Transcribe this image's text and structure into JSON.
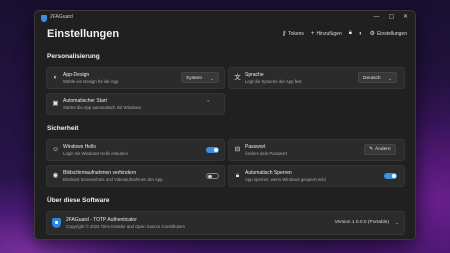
{
  "window": {
    "app_name": "2FAGuard",
    "controls": {
      "minimize": "—",
      "maximize": "▢",
      "close": "✕"
    }
  },
  "page": {
    "heading": "Einstellungen"
  },
  "toolbar": {
    "tokens": "Tokens",
    "add": "Hinzufügen",
    "settings": "Einstellungen"
  },
  "sections": {
    "personalization": "Personalisierung",
    "security": "Sicherheit",
    "about": "Über diese Software"
  },
  "personalization": {
    "design": {
      "title": "App-Design",
      "desc": "Wähle ein Design für die App",
      "value": "System"
    },
    "language": {
      "title": "Sprache",
      "desc": "Legt die Sprache der App fest",
      "value": "Deutsch"
    },
    "autostart": {
      "title": "Automatischer Start",
      "desc": "Startet die App automatisch mit Windows",
      "enabled": false
    }
  },
  "security": {
    "hello": {
      "title": "Windows Hello",
      "desc": "Login mit Windows Hello erlauben",
      "enabled": true
    },
    "password": {
      "title": "Passwort",
      "desc": "Ändere dein Passwort",
      "button": "Ändern"
    },
    "screenshots": {
      "title": "Bildschirmaufnahmen verhindern",
      "desc": "Blockiert Screenshots und Videoaufnahmen der App",
      "enabled": false
    },
    "autolock": {
      "title": "Automatisch Sperren",
      "desc": "App sperren, wenn Windows gesperrt wird",
      "enabled": true
    }
  },
  "about": {
    "title": "2FAGuard - TOTP Authenticator",
    "copyright": "Copyright © 2024 Timo Kössler and Open Source Contributors",
    "version": "Version 1.0.0.0 (Portable)"
  },
  "colors": {
    "accent": "#3b8fe0",
    "card": "#2b2b2b",
    "window": "#202020"
  }
}
